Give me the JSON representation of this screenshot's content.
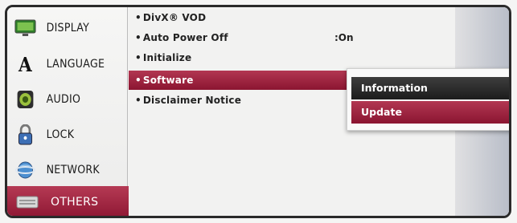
{
  "sidebar": {
    "items": [
      {
        "label": "DISPLAY",
        "icon": "display-icon"
      },
      {
        "label": "LANGUAGE",
        "icon": "language-icon"
      },
      {
        "label": "AUDIO",
        "icon": "audio-icon"
      },
      {
        "label": "LOCK",
        "icon": "lock-icon"
      },
      {
        "label": "NETWORK",
        "icon": "network-icon"
      },
      {
        "label": "OTHERS",
        "icon": "others-icon",
        "active": true
      }
    ]
  },
  "glyphs": {
    "language_letter": "A"
  },
  "menu": {
    "bullet": "•",
    "options": [
      {
        "label": "DivX® VOD"
      },
      {
        "label": "Auto Power Off",
        "value": ":On"
      },
      {
        "label": "Initialize"
      },
      {
        "label": "Software",
        "selected": true
      },
      {
        "label": "Disclaimer Notice"
      }
    ]
  },
  "popup": {
    "items": [
      {
        "label": "Information",
        "highlighted": false
      },
      {
        "label": "Update",
        "highlighted": true
      }
    ]
  },
  "colors": {
    "accent": "#a52644",
    "dark_highlight": "#2a2a2a"
  }
}
